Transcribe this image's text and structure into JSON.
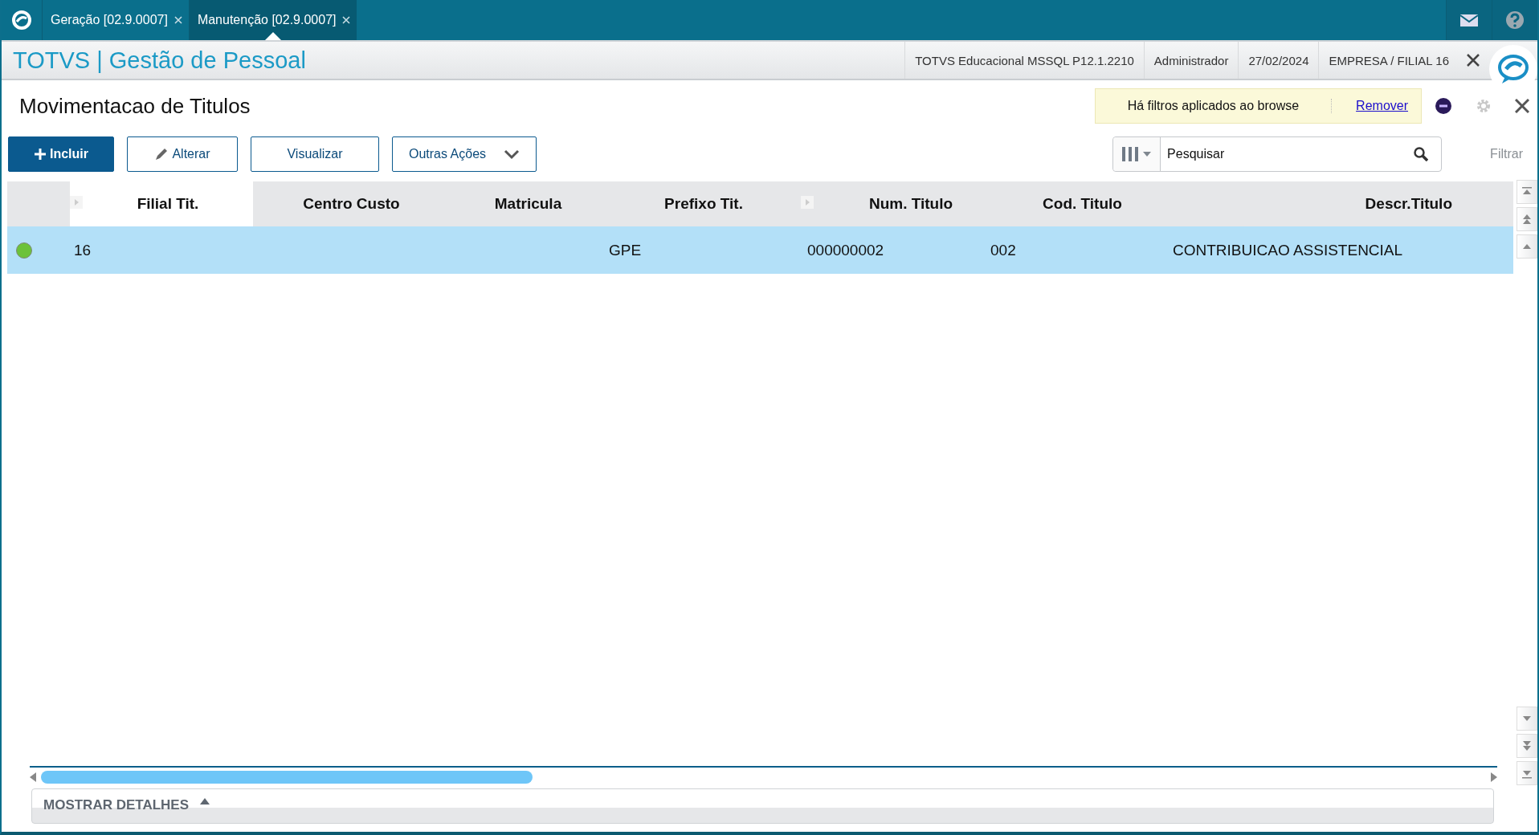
{
  "app_tabs": [
    {
      "label": "Geração [02.9.0007]",
      "selected": false
    },
    {
      "label": "Manutenção [02.9.0007]",
      "selected": true
    }
  ],
  "header": {
    "title": "TOTVS | Gestão de Pessoal",
    "info": [
      "TOTVS Educacional MSSQL P12.1.2210",
      "Administrador",
      "27/02/2024",
      "EMPRESA / FILIAL 16"
    ]
  },
  "page": {
    "title": "Movimentacao de Titulos",
    "filter_notice": "Há filtros aplicados ao browse",
    "filter_remove": "Remover"
  },
  "actions": [
    {
      "label": "Incluir",
      "kind": "primary"
    },
    {
      "label": "Alterar",
      "kind": "edit"
    },
    {
      "label": "Visualizar",
      "kind": "plain"
    },
    {
      "label": "Outras Ações",
      "kind": "menu"
    }
  ],
  "search": {
    "placeholder": "Pesquisar",
    "filter_label": "Filtrar"
  },
  "table": {
    "columns": [
      "Filial Tit.",
      "Centro Custo",
      "Matricula",
      "Prefixo Tit.",
      "Num. Titulo",
      "Cod. Titulo",
      "Descr.Titulo"
    ],
    "rows": [
      {
        "color": "#6cc23a",
        "selected": true,
        "filial": "16",
        "prefixo": "GPE",
        "num": "000000002",
        "cod": "002",
        "descr": "CONTRIBUICAO ASSISTENCIAL"
      }
    ]
  },
  "details": {
    "label": "MOSTRAR DETALHES"
  }
}
